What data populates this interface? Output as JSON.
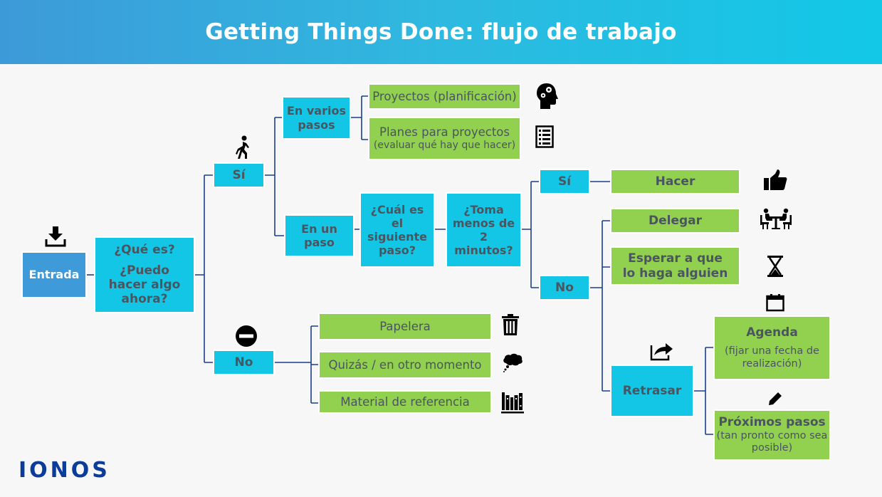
{
  "header": {
    "title": "Getting Things Done: flujo de trabajo"
  },
  "colors": {
    "decision_box": "#13c6e6",
    "entry_box": "#3e9ad8",
    "action_box": "#92d050",
    "connector": "#1a3f8a",
    "logo": "#0b3c9a"
  },
  "nodes": {
    "entrada": "Entrada",
    "que_es": "¿Qué es?",
    "puedo_hacer": "¿Puedo hacer algo ahora?",
    "si": "Sí",
    "no": "No",
    "varios_pasos": "En varios pasos",
    "un_paso": "En un paso",
    "proyectos": "Proyectos (planificación)",
    "planes": "Planes para proyectos",
    "planes_sub": "(evaluar qué hay que hacer)",
    "siguiente_paso": "¿Cuál es el siguiente paso?",
    "dos_minutos": "¿Toma menos de 2 minutos?",
    "si2": "Sí",
    "no2": "No",
    "hacer": "Hacer",
    "delegar": "Delegar",
    "esperar": "Esperar a que lo haga alguien",
    "retrasar": "Retrasar",
    "agenda": "Agenda",
    "agenda_sub": "(fijar una fecha de realización)",
    "proximos": "Próximos pasos",
    "proximos_sub": "(tan pronto como sea posible)",
    "papelera": "Papelera",
    "quizas": "Quizás / en otro momento",
    "referencia": "Material de referencia"
  },
  "icons": [
    "download-icon",
    "walking-person-icon",
    "no-entry-icon",
    "head-gears-icon",
    "checklist-icon",
    "thumbs-up-icon",
    "meeting-icon",
    "hourglass-icon",
    "calendar-icon",
    "share-icon",
    "pencil-icon",
    "trash-icon",
    "thought-cloud-icon",
    "books-icon"
  ],
  "logo": {
    "text": "IONOS"
  }
}
